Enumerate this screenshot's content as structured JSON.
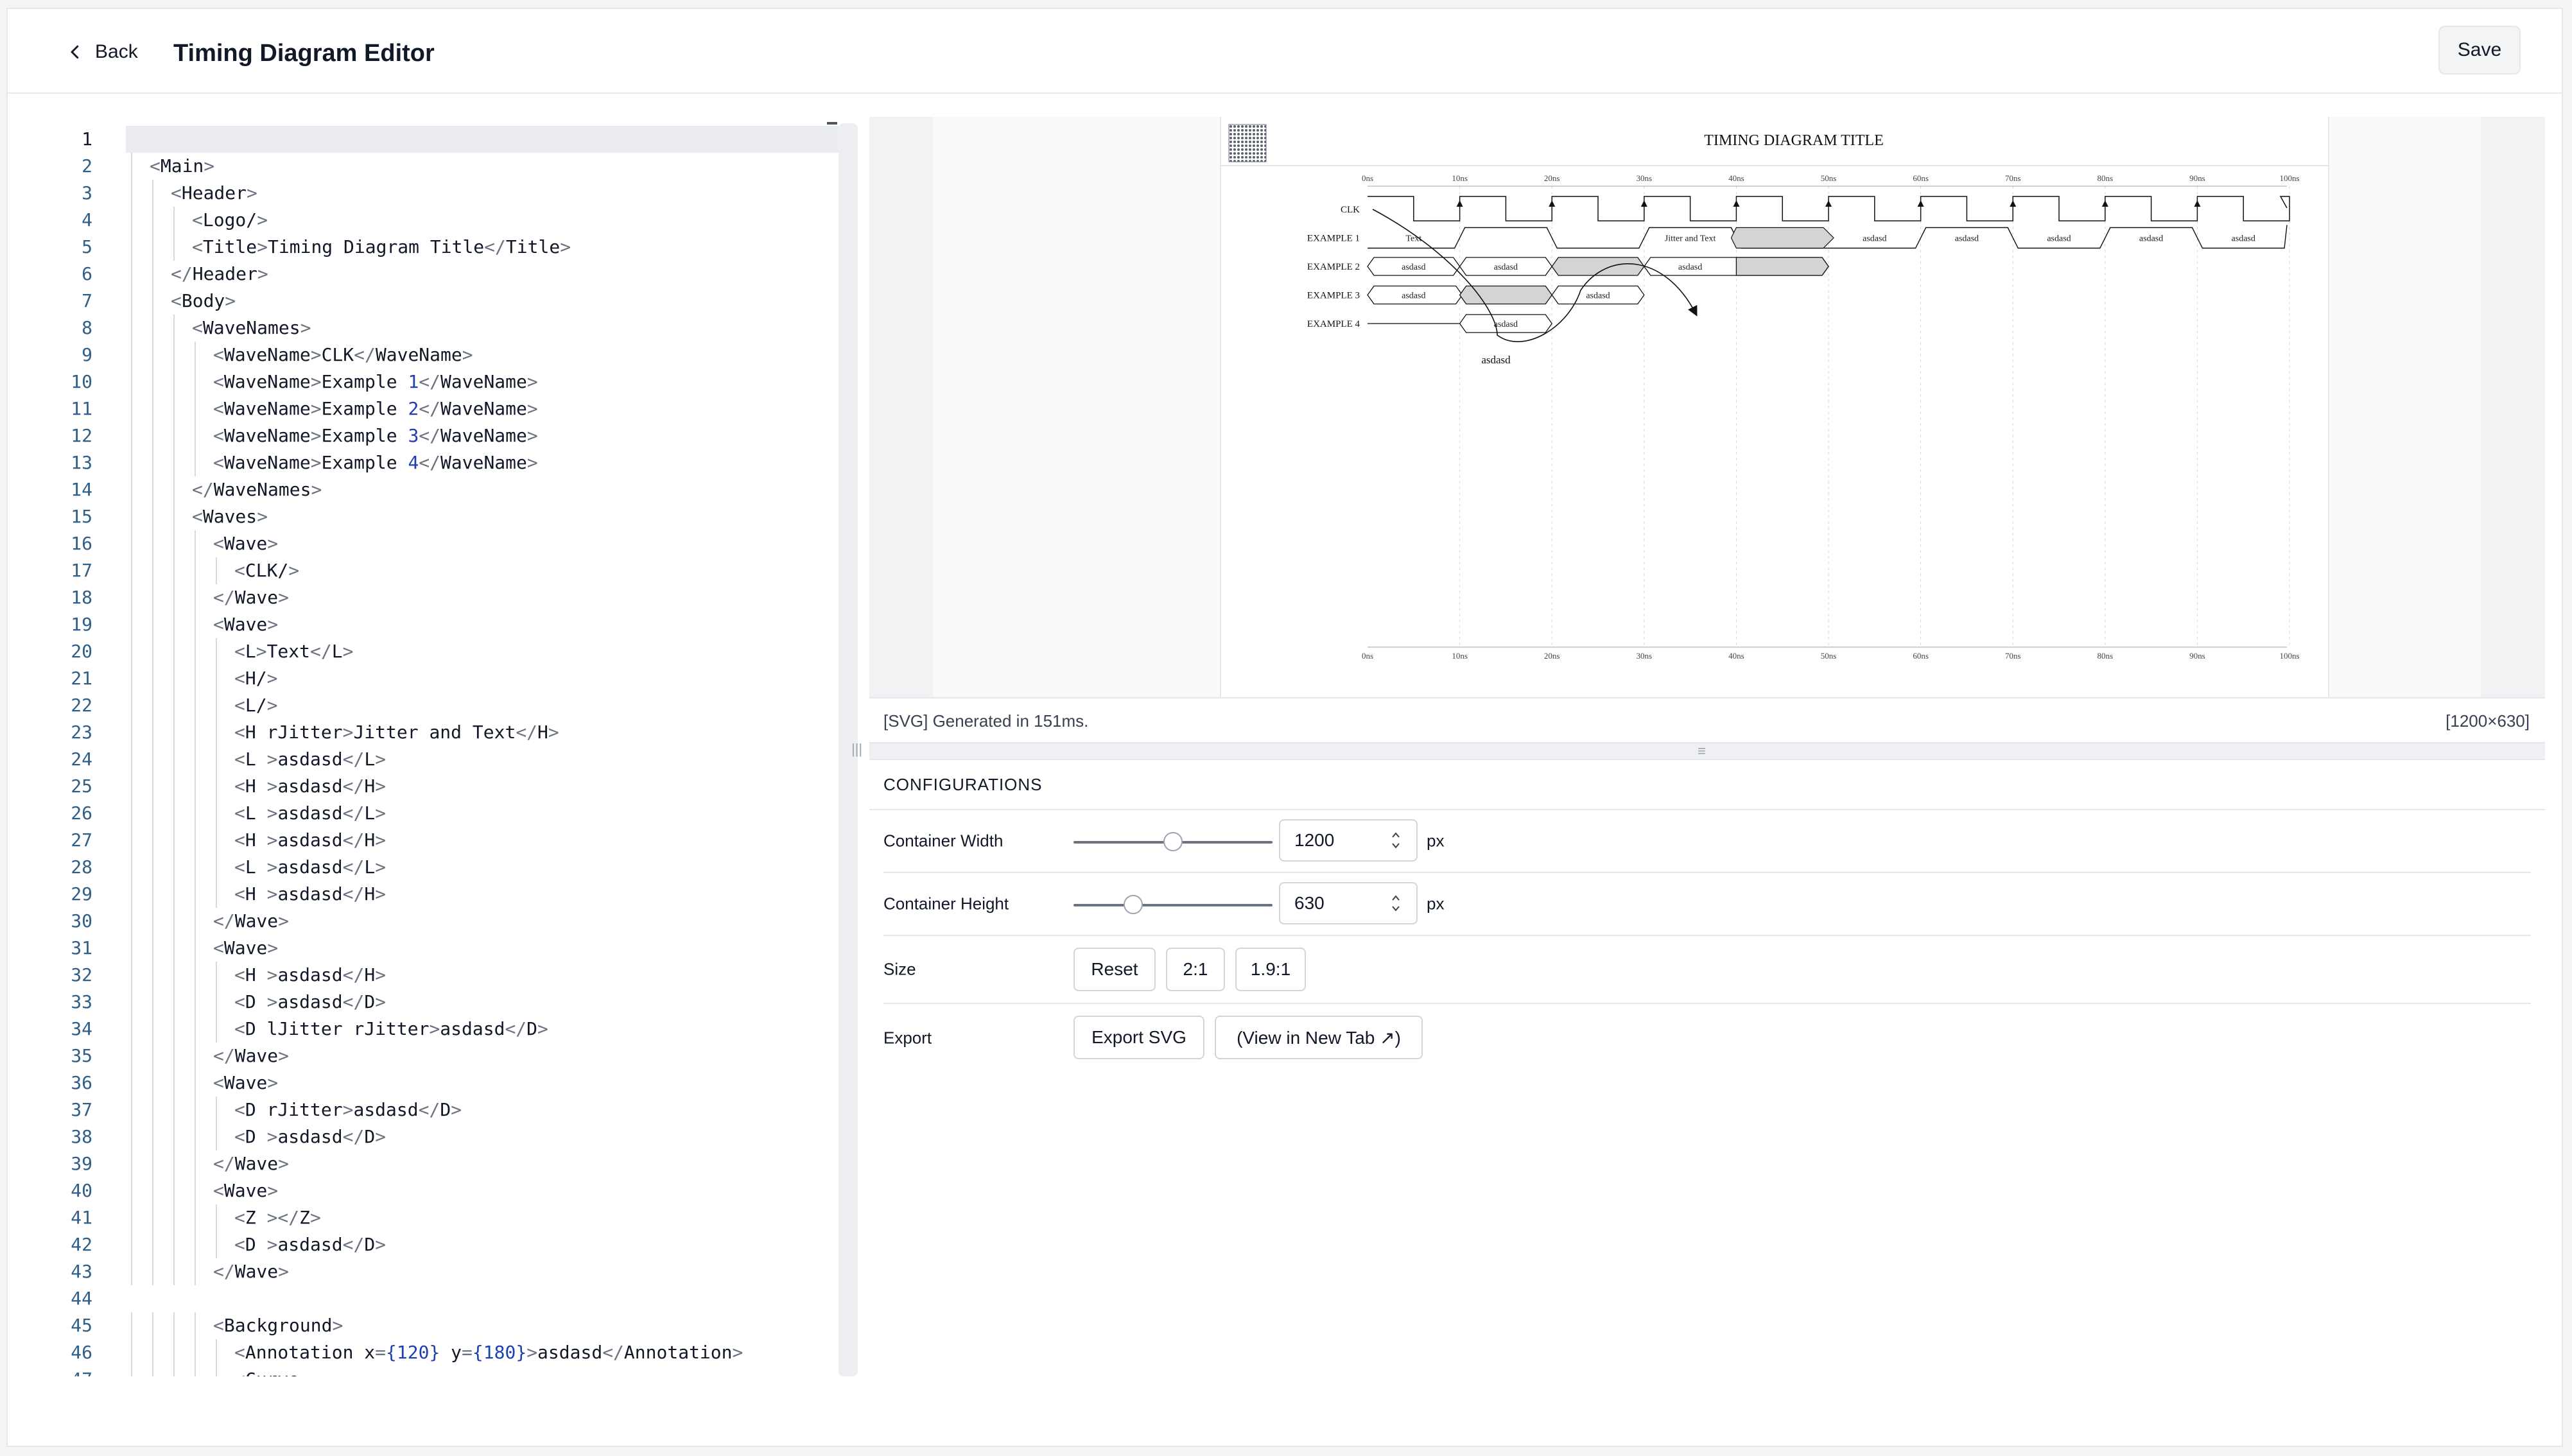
{
  "header": {
    "back_label": "Back",
    "title": "Timing Diagram Editor",
    "save_label": "Save"
  },
  "editor": {
    "lines": [
      [
        {
          "c": "m",
          "t": ""
        }
      ],
      [
        {
          "c": "t",
          "t": "<"
        },
        {
          "c": "",
          "t": "Main"
        },
        {
          "c": "t",
          "t": ">"
        }
      ],
      [
        {
          "c": "t",
          "t": "<"
        },
        {
          "c": "",
          "t": "Header"
        },
        {
          "c": "t",
          "t": ">"
        }
      ],
      [
        {
          "c": "t",
          "t": "<"
        },
        {
          "c": "",
          "t": "Logo/"
        },
        {
          "c": "t",
          "t": ">"
        }
      ],
      [
        {
          "c": "t",
          "t": "<"
        },
        {
          "c": "",
          "t": "Title"
        },
        {
          "c": "t",
          "t": ">"
        },
        {
          "c": "",
          "t": "Timing Diagram Title"
        },
        {
          "c": "t",
          "t": "</"
        },
        {
          "c": "",
          "t": "Title"
        },
        {
          "c": "t",
          "t": ">"
        }
      ],
      [
        {
          "c": "t",
          "t": "</"
        },
        {
          "c": "",
          "t": "Header"
        },
        {
          "c": "t",
          "t": ">"
        }
      ],
      [
        {
          "c": "t",
          "t": "<"
        },
        {
          "c": "",
          "t": "Body"
        },
        {
          "c": "t",
          "t": ">"
        }
      ],
      [
        {
          "c": "t",
          "t": "<"
        },
        {
          "c": "",
          "t": "WaveNames"
        },
        {
          "c": "t",
          "t": ">"
        }
      ],
      [
        {
          "c": "t",
          "t": "<"
        },
        {
          "c": "",
          "t": "WaveName"
        },
        {
          "c": "t",
          "t": ">"
        },
        {
          "c": "",
          "t": "CLK"
        },
        {
          "c": "t",
          "t": "</"
        },
        {
          "c": "",
          "t": "WaveName"
        },
        {
          "c": "t",
          "t": ">"
        }
      ],
      [
        {
          "c": "t",
          "t": "<"
        },
        {
          "c": "",
          "t": "WaveName"
        },
        {
          "c": "t",
          "t": ">"
        },
        {
          "c": "",
          "t": "Example "
        },
        {
          "c": "n",
          "t": "1"
        },
        {
          "c": "t",
          "t": "</"
        },
        {
          "c": "",
          "t": "WaveName"
        },
        {
          "c": "t",
          "t": ">"
        }
      ],
      [
        {
          "c": "t",
          "t": "<"
        },
        {
          "c": "",
          "t": "WaveName"
        },
        {
          "c": "t",
          "t": ">"
        },
        {
          "c": "",
          "t": "Example "
        },
        {
          "c": "n",
          "t": "2"
        },
        {
          "c": "t",
          "t": "</"
        },
        {
          "c": "",
          "t": "WaveName"
        },
        {
          "c": "t",
          "t": ">"
        }
      ],
      [
        {
          "c": "t",
          "t": "<"
        },
        {
          "c": "",
          "t": "WaveName"
        },
        {
          "c": "t",
          "t": ">"
        },
        {
          "c": "",
          "t": "Example "
        },
        {
          "c": "n",
          "t": "3"
        },
        {
          "c": "t",
          "t": "</"
        },
        {
          "c": "",
          "t": "WaveName"
        },
        {
          "c": "t",
          "t": ">"
        }
      ],
      [
        {
          "c": "t",
          "t": "<"
        },
        {
          "c": "",
          "t": "WaveName"
        },
        {
          "c": "t",
          "t": ">"
        },
        {
          "c": "",
          "t": "Example "
        },
        {
          "c": "n",
          "t": "4"
        },
        {
          "c": "t",
          "t": "</"
        },
        {
          "c": "",
          "t": "WaveName"
        },
        {
          "c": "t",
          "t": ">"
        }
      ],
      [
        {
          "c": "t",
          "t": "</"
        },
        {
          "c": "",
          "t": "WaveNames"
        },
        {
          "c": "t",
          "t": ">"
        }
      ],
      [
        {
          "c": "t",
          "t": "<"
        },
        {
          "c": "",
          "t": "Waves"
        },
        {
          "c": "t",
          "t": ">"
        }
      ],
      [
        {
          "c": "t",
          "t": "<"
        },
        {
          "c": "",
          "t": "Wave"
        },
        {
          "c": "t",
          "t": ">"
        }
      ],
      [
        {
          "c": "t",
          "t": "<"
        },
        {
          "c": "",
          "t": "CLK/"
        },
        {
          "c": "t",
          "t": ">"
        }
      ],
      [
        {
          "c": "t",
          "t": "</"
        },
        {
          "c": "",
          "t": "Wave"
        },
        {
          "c": "t",
          "t": ">"
        }
      ],
      [
        {
          "c": "t",
          "t": "<"
        },
        {
          "c": "",
          "t": "Wave"
        },
        {
          "c": "t",
          "t": ">"
        }
      ],
      [
        {
          "c": "t",
          "t": "<"
        },
        {
          "c": "",
          "t": "L"
        },
        {
          "c": "t",
          "t": ">"
        },
        {
          "c": "",
          "t": "Text"
        },
        {
          "c": "t",
          "t": "</"
        },
        {
          "c": "",
          "t": "L"
        },
        {
          "c": "t",
          "t": ">"
        }
      ],
      [
        {
          "c": "t",
          "t": "<"
        },
        {
          "c": "",
          "t": "H/"
        },
        {
          "c": "t",
          "t": ">"
        }
      ],
      [
        {
          "c": "t",
          "t": "<"
        },
        {
          "c": "",
          "t": "L/"
        },
        {
          "c": "t",
          "t": ">"
        }
      ],
      [
        {
          "c": "t",
          "t": "<"
        },
        {
          "c": "",
          "t": "H rJitter"
        },
        {
          "c": "t",
          "t": ">"
        },
        {
          "c": "",
          "t": "Jitter and Text"
        },
        {
          "c": "t",
          "t": "</"
        },
        {
          "c": "",
          "t": "H"
        },
        {
          "c": "t",
          "t": ">"
        }
      ],
      [
        {
          "c": "t",
          "t": "<"
        },
        {
          "c": "",
          "t": "L "
        },
        {
          "c": "t",
          "t": ">"
        },
        {
          "c": "",
          "t": "asdasd"
        },
        {
          "c": "t",
          "t": "</"
        },
        {
          "c": "",
          "t": "L"
        },
        {
          "c": "t",
          "t": ">"
        }
      ],
      [
        {
          "c": "t",
          "t": "<"
        },
        {
          "c": "",
          "t": "H "
        },
        {
          "c": "t",
          "t": ">"
        },
        {
          "c": "",
          "t": "asdasd"
        },
        {
          "c": "t",
          "t": "</"
        },
        {
          "c": "",
          "t": "H"
        },
        {
          "c": "t",
          "t": ">"
        }
      ],
      [
        {
          "c": "t",
          "t": "<"
        },
        {
          "c": "",
          "t": "L "
        },
        {
          "c": "t",
          "t": ">"
        },
        {
          "c": "",
          "t": "asdasd"
        },
        {
          "c": "t",
          "t": "</"
        },
        {
          "c": "",
          "t": "L"
        },
        {
          "c": "t",
          "t": ">"
        }
      ],
      [
        {
          "c": "t",
          "t": "<"
        },
        {
          "c": "",
          "t": "H "
        },
        {
          "c": "t",
          "t": ">"
        },
        {
          "c": "",
          "t": "asdasd"
        },
        {
          "c": "t",
          "t": "</"
        },
        {
          "c": "",
          "t": "H"
        },
        {
          "c": "t",
          "t": ">"
        }
      ],
      [
        {
          "c": "t",
          "t": "<"
        },
        {
          "c": "",
          "t": "L "
        },
        {
          "c": "t",
          "t": ">"
        },
        {
          "c": "",
          "t": "asdasd"
        },
        {
          "c": "t",
          "t": "</"
        },
        {
          "c": "",
          "t": "L"
        },
        {
          "c": "t",
          "t": ">"
        }
      ],
      [
        {
          "c": "t",
          "t": "<"
        },
        {
          "c": "",
          "t": "H "
        },
        {
          "c": "t",
          "t": ">"
        },
        {
          "c": "",
          "t": "asdasd"
        },
        {
          "c": "t",
          "t": "</"
        },
        {
          "c": "",
          "t": "H"
        },
        {
          "c": "t",
          "t": ">"
        }
      ],
      [
        {
          "c": "t",
          "t": "</"
        },
        {
          "c": "",
          "t": "Wave"
        },
        {
          "c": "t",
          "t": ">"
        }
      ],
      [
        {
          "c": "t",
          "t": "<"
        },
        {
          "c": "",
          "t": "Wave"
        },
        {
          "c": "t",
          "t": ">"
        }
      ],
      [
        {
          "c": "t",
          "t": "<"
        },
        {
          "c": "",
          "t": "H "
        },
        {
          "c": "t",
          "t": ">"
        },
        {
          "c": "",
          "t": "asdasd"
        },
        {
          "c": "t",
          "t": "</"
        },
        {
          "c": "",
          "t": "H"
        },
        {
          "c": "t",
          "t": ">"
        }
      ],
      [
        {
          "c": "t",
          "t": "<"
        },
        {
          "c": "",
          "t": "D "
        },
        {
          "c": "t",
          "t": ">"
        },
        {
          "c": "",
          "t": "asdasd"
        },
        {
          "c": "t",
          "t": "</"
        },
        {
          "c": "",
          "t": "D"
        },
        {
          "c": "t",
          "t": ">"
        }
      ],
      [
        {
          "c": "t",
          "t": "<"
        },
        {
          "c": "",
          "t": "D lJitter rJitter"
        },
        {
          "c": "t",
          "t": ">"
        },
        {
          "c": "",
          "t": "asdasd"
        },
        {
          "c": "t",
          "t": "</"
        },
        {
          "c": "",
          "t": "D"
        },
        {
          "c": "t",
          "t": ">"
        }
      ],
      [
        {
          "c": "t",
          "t": "</"
        },
        {
          "c": "",
          "t": "Wave"
        },
        {
          "c": "t",
          "t": ">"
        }
      ],
      [
        {
          "c": "t",
          "t": "<"
        },
        {
          "c": "",
          "t": "Wave"
        },
        {
          "c": "t",
          "t": ">"
        }
      ],
      [
        {
          "c": "t",
          "t": "<"
        },
        {
          "c": "",
          "t": "D rJitter"
        },
        {
          "c": "t",
          "t": ">"
        },
        {
          "c": "",
          "t": "asdasd"
        },
        {
          "c": "t",
          "t": "</"
        },
        {
          "c": "",
          "t": "D"
        },
        {
          "c": "t",
          "t": ">"
        }
      ],
      [
        {
          "c": "t",
          "t": "<"
        },
        {
          "c": "",
          "t": "D "
        },
        {
          "c": "t",
          "t": ">"
        },
        {
          "c": "",
          "t": "asdasd"
        },
        {
          "c": "t",
          "t": "</"
        },
        {
          "c": "",
          "t": "D"
        },
        {
          "c": "t",
          "t": ">"
        }
      ],
      [
        {
          "c": "t",
          "t": "</"
        },
        {
          "c": "",
          "t": "Wave"
        },
        {
          "c": "t",
          "t": ">"
        }
      ],
      [
        {
          "c": "t",
          "t": "<"
        },
        {
          "c": "",
          "t": "Wave"
        },
        {
          "c": "t",
          "t": ">"
        }
      ],
      [
        {
          "c": "t",
          "t": "<"
        },
        {
          "c": "",
          "t": "Z "
        },
        {
          "c": "t",
          "t": "></"
        },
        {
          "c": "",
          "t": "Z"
        },
        {
          "c": "t",
          "t": ">"
        }
      ],
      [
        {
          "c": "t",
          "t": "<"
        },
        {
          "c": "",
          "t": "D "
        },
        {
          "c": "t",
          "t": ">"
        },
        {
          "c": "",
          "t": "asdasd"
        },
        {
          "c": "t",
          "t": "</"
        },
        {
          "c": "",
          "t": "D"
        },
        {
          "c": "t",
          "t": ">"
        }
      ],
      [
        {
          "c": "t",
          "t": "</"
        },
        {
          "c": "",
          "t": "Wave"
        },
        {
          "c": "t",
          "t": ">"
        }
      ],
      [
        {
          "c": "m",
          "t": ""
        }
      ],
      [
        {
          "c": "t",
          "t": "<"
        },
        {
          "c": "",
          "t": "Background"
        },
        {
          "c": "t",
          "t": ">"
        }
      ],
      [
        {
          "c": "t",
          "t": "<"
        },
        {
          "c": "",
          "t": "Annotation x"
        },
        {
          "c": "t",
          "t": "="
        },
        {
          "c": "n",
          "t": "{120}"
        },
        {
          "c": "",
          "t": " y"
        },
        {
          "c": "t",
          "t": "="
        },
        {
          "c": "n",
          "t": "{180}"
        },
        {
          "c": "t",
          "t": ">"
        },
        {
          "c": "",
          "t": "asdasd"
        },
        {
          "c": "t",
          "t": "</"
        },
        {
          "c": "",
          "t": "Annotation"
        },
        {
          "c": "t",
          "t": ">"
        }
      ],
      [
        {
          "c": "t",
          "t": "<"
        },
        {
          "c": "",
          "t": "Curve"
        }
      ]
    ]
  },
  "preview": {
    "diagram_title": "TIMING DIAGRAM TITLE",
    "time_ticks": [
      "0ns",
      "10ns",
      "20ns",
      "30ns",
      "40ns",
      "50ns",
      "60ns",
      "70ns",
      "80ns",
      "90ns",
      "100ns"
    ],
    "wave_names": [
      "CLK",
      "EXAMPLE 1",
      "EXAMPLE 2",
      "EXAMPLE 3",
      "EXAMPLE 4"
    ],
    "ex1_labels": [
      "Text",
      "Jitter and Text",
      "asdasd",
      "asdasd",
      "asdasd",
      "asdasd",
      "asdasd"
    ],
    "ex2_labels": [
      "asdasd",
      "asdasd",
      "asdasd"
    ],
    "ex3_labels": [
      "asdasd",
      "asdasd"
    ],
    "ex4_labels": [
      "asdasd"
    ],
    "annotation": "asdasd"
  },
  "status": {
    "generated": "[SVG] Generated in 151ms.",
    "dimensions": "[1200×630]"
  },
  "config": {
    "heading": "CONFIGURATIONS",
    "width": {
      "label": "Container Width",
      "value": "1200",
      "unit": "px",
      "slider_fraction": 0.5
    },
    "height": {
      "label": "Container Height",
      "value": "630",
      "unit": "px",
      "slider_fraction": 0.3
    },
    "size": {
      "label": "Size",
      "buttons": [
        "Reset",
        "2:1",
        "1.9:1"
      ]
    },
    "export": {
      "label": "Export",
      "buttons": [
        "Export SVG",
        "(View in New Tab ↗)"
      ]
    }
  },
  "colors": {
    "accent": "#1e40af",
    "border": "#e5e7eb",
    "shade": "#d4d4d4"
  }
}
